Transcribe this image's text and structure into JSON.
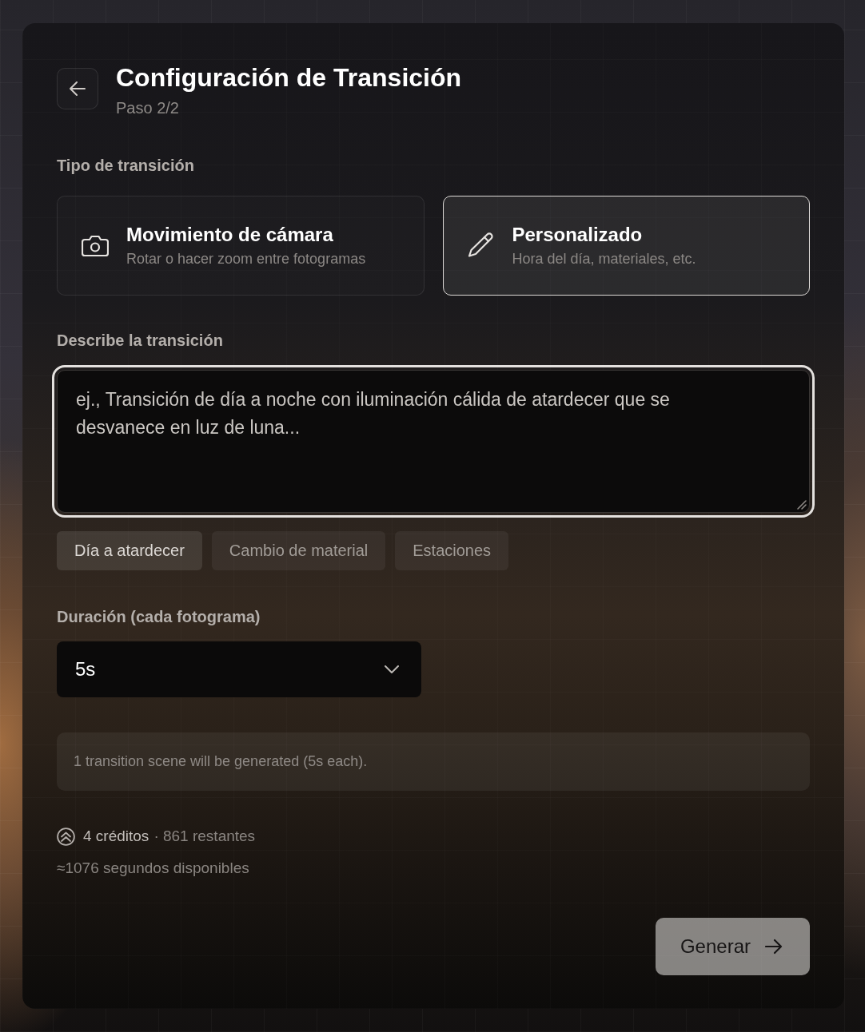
{
  "header": {
    "title": "Configuración de Transición",
    "step": "Paso 2/2"
  },
  "transition_type": {
    "label": "Tipo de transición",
    "options": [
      {
        "kind": "camera",
        "title": "Movimiento de cámara",
        "description": "Rotar o hacer zoom entre fotogramas",
        "selected": false
      },
      {
        "kind": "custom",
        "title": "Personalizado",
        "description": "Hora del día, materiales, etc.",
        "selected": true
      }
    ]
  },
  "description": {
    "label": "Describe la transición",
    "placeholder": "ej., Transición de día a noche con iluminación cálida de atardecer que se desvanece en luz de luna...",
    "focused": true
  },
  "presets": [
    {
      "label": "Día a atardecer",
      "selected": true
    },
    {
      "label": "Cambio de material",
      "selected": false
    },
    {
      "label": "Estaciones",
      "selected": false
    }
  ],
  "duration": {
    "label": "Duración (cada fotograma)",
    "value": "5s"
  },
  "info": "1 transition scene will be generated (5s each).",
  "credits": {
    "cost": "4 créditos",
    "remaining": "· 861 restantes",
    "seconds": "≈1076 segundos disponibles"
  },
  "generate_button": {
    "label": "Generar",
    "disabled": true
  }
}
